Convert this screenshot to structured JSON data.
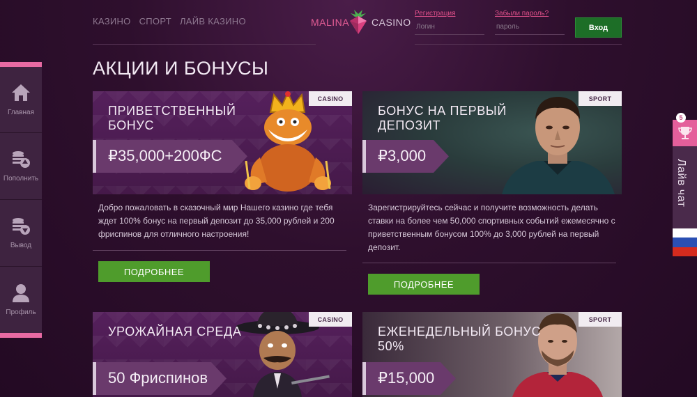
{
  "nav": {
    "items": [
      "КАЗИНО",
      "СПОРТ",
      "ЛАЙВ КАЗИНО"
    ]
  },
  "logo": {
    "word1": "MALINA",
    "word2": "CASINO"
  },
  "auth": {
    "register_link": "Регистрация",
    "login_placeholder": "Логин",
    "forgot_link": "Забыли пароль?",
    "password_placeholder": "пароль",
    "login_button": "Вход"
  },
  "page_title": "АКЦИИ И БОНУСЫ",
  "sidebar": {
    "items": [
      {
        "label": "Главная",
        "icon": "home-icon"
      },
      {
        "label": "Пополнить",
        "icon": "deposit-coins-icon"
      },
      {
        "label": "Вывод",
        "icon": "withdraw-coins-icon"
      },
      {
        "label": "Профиль",
        "icon": "user-icon"
      }
    ]
  },
  "right_tab": {
    "badge": "5",
    "chat_label": "Лайв чат",
    "flag_colors": [
      "#ffffff",
      "#2a4fb3",
      "#d52b1e"
    ],
    "accent": "#e45f9b"
  },
  "cards": [
    {
      "tag": "CASINO",
      "title": "ПРИВЕТСТВЕННЫЙ БОНУС",
      "amount": "₽35,000+200ФС",
      "description": "Добро пожаловать в сказочный мир Нашего казино где тебя ждет 100% бонус на первый депозит до 35,000 рублей и 200 фриспинов для отличного настроения!",
      "button": "ПОДРОБНЕЕ"
    },
    {
      "tag": "SPORT",
      "title": "БОНУС НА ПЕРВЫЙ ДЕПОЗИТ",
      "amount": "₽3,000",
      "description": "Зарегистрируйтесь сейчас и получите возможность делать ставки на более чем 50,000 спортивных событий ежемесячно с приветственным бонусом 100% до 3,000 рублей на первый депозит.",
      "button": "ПОДРОБНЕЕ"
    },
    {
      "tag": "CASINO",
      "title": "УРОЖАЙНАЯ СРЕДА",
      "amount": "50 Фриспинов"
    },
    {
      "tag": "SPORT",
      "title": "ЕЖЕНЕДЕЛЬНЫЙ БОНУС 50%",
      "amount": "₽15,000"
    }
  ],
  "colors": {
    "background": "#2e0f2d",
    "accent_pink": "#e86aa3",
    "button_green": "#4f9c2c",
    "login_green": "#1d6e27"
  }
}
